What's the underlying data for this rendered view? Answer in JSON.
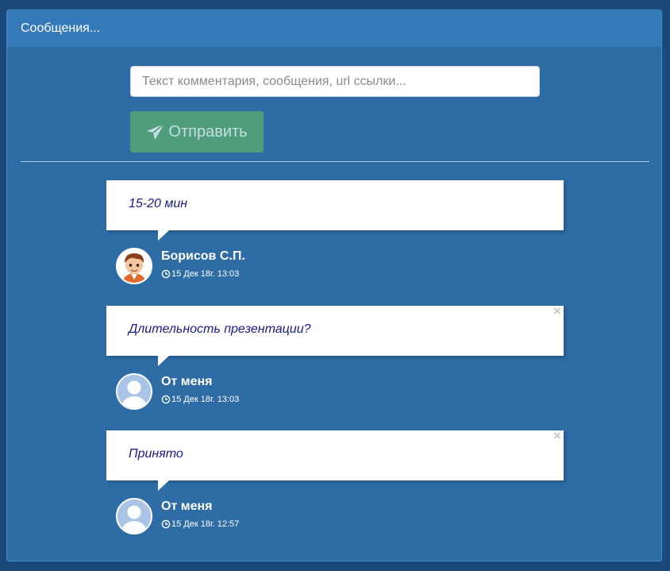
{
  "panel": {
    "title": "Сообщения..."
  },
  "composer": {
    "placeholder": "Текст комментария, сообщения, url ссылки...",
    "value": "",
    "send_label": "Отправить",
    "send_icon": "paper-plane-icon"
  },
  "messages": [
    {
      "text": "15-20 мин",
      "author": "Борисов С.П.",
      "timestamp": "15 Дек 18г. 13:03",
      "avatar": "boy-avatar",
      "deletable": false
    },
    {
      "text": "Длительность презентации?",
      "author": "От меня",
      "timestamp": "15 Дек 18г. 13:03",
      "avatar": "default-user-avatar",
      "deletable": true,
      "close_label": "×"
    },
    {
      "text": "Принято",
      "author": "От меня",
      "timestamp": "15 Дек 18г. 12:57",
      "avatar": "default-user-avatar",
      "deletable": true,
      "close_label": "×"
    }
  ],
  "colors": {
    "page_background": "#1b4a7a",
    "panel_background": "#2e6ca6",
    "header_background": "#347ab8",
    "send_button": "#4e9e7b",
    "message_text": "#1a1a8a"
  }
}
